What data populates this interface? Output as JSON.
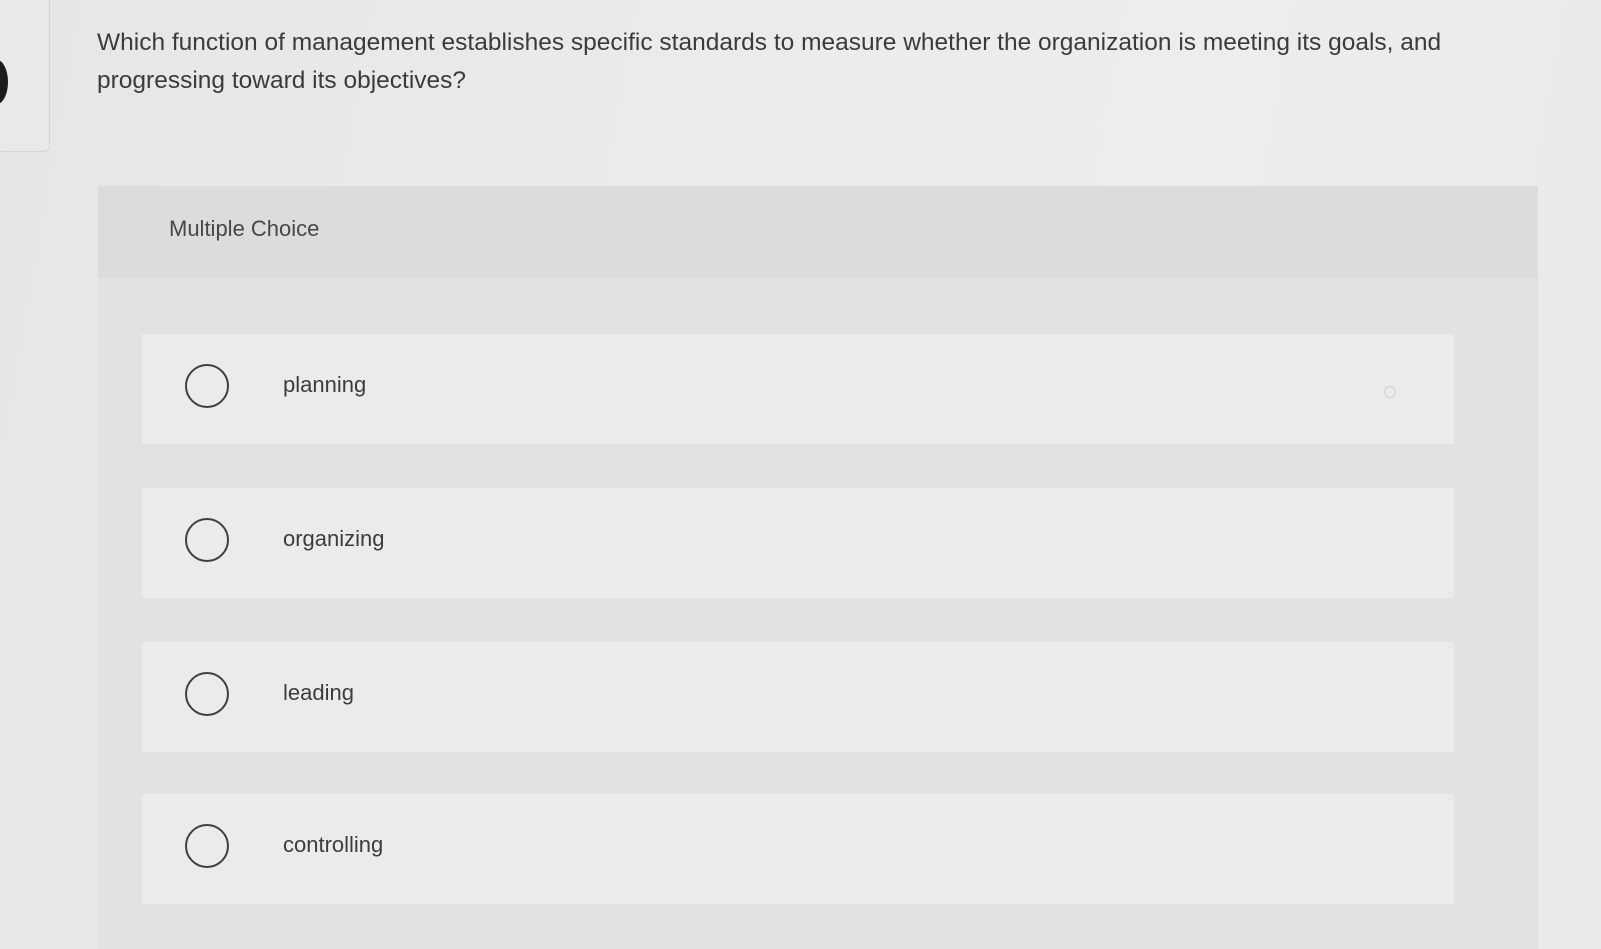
{
  "question": {
    "text": "Which function of management establishes specific standards to measure whether the organization is meeting its goals, and progressing toward its objectives?"
  },
  "multiple_choice": {
    "label": "Multiple Choice",
    "options": [
      {
        "label": "planning",
        "selected": false
      },
      {
        "label": "organizing",
        "selected": false
      },
      {
        "label": "leading",
        "selected": false
      },
      {
        "label": "controlling",
        "selected": false
      }
    ]
  },
  "colors": {
    "background": "#ebebeb",
    "card": "#e2e2e2",
    "header": "#dcdcdc",
    "option": "#ebebeb",
    "text": "#3b3b3b"
  }
}
